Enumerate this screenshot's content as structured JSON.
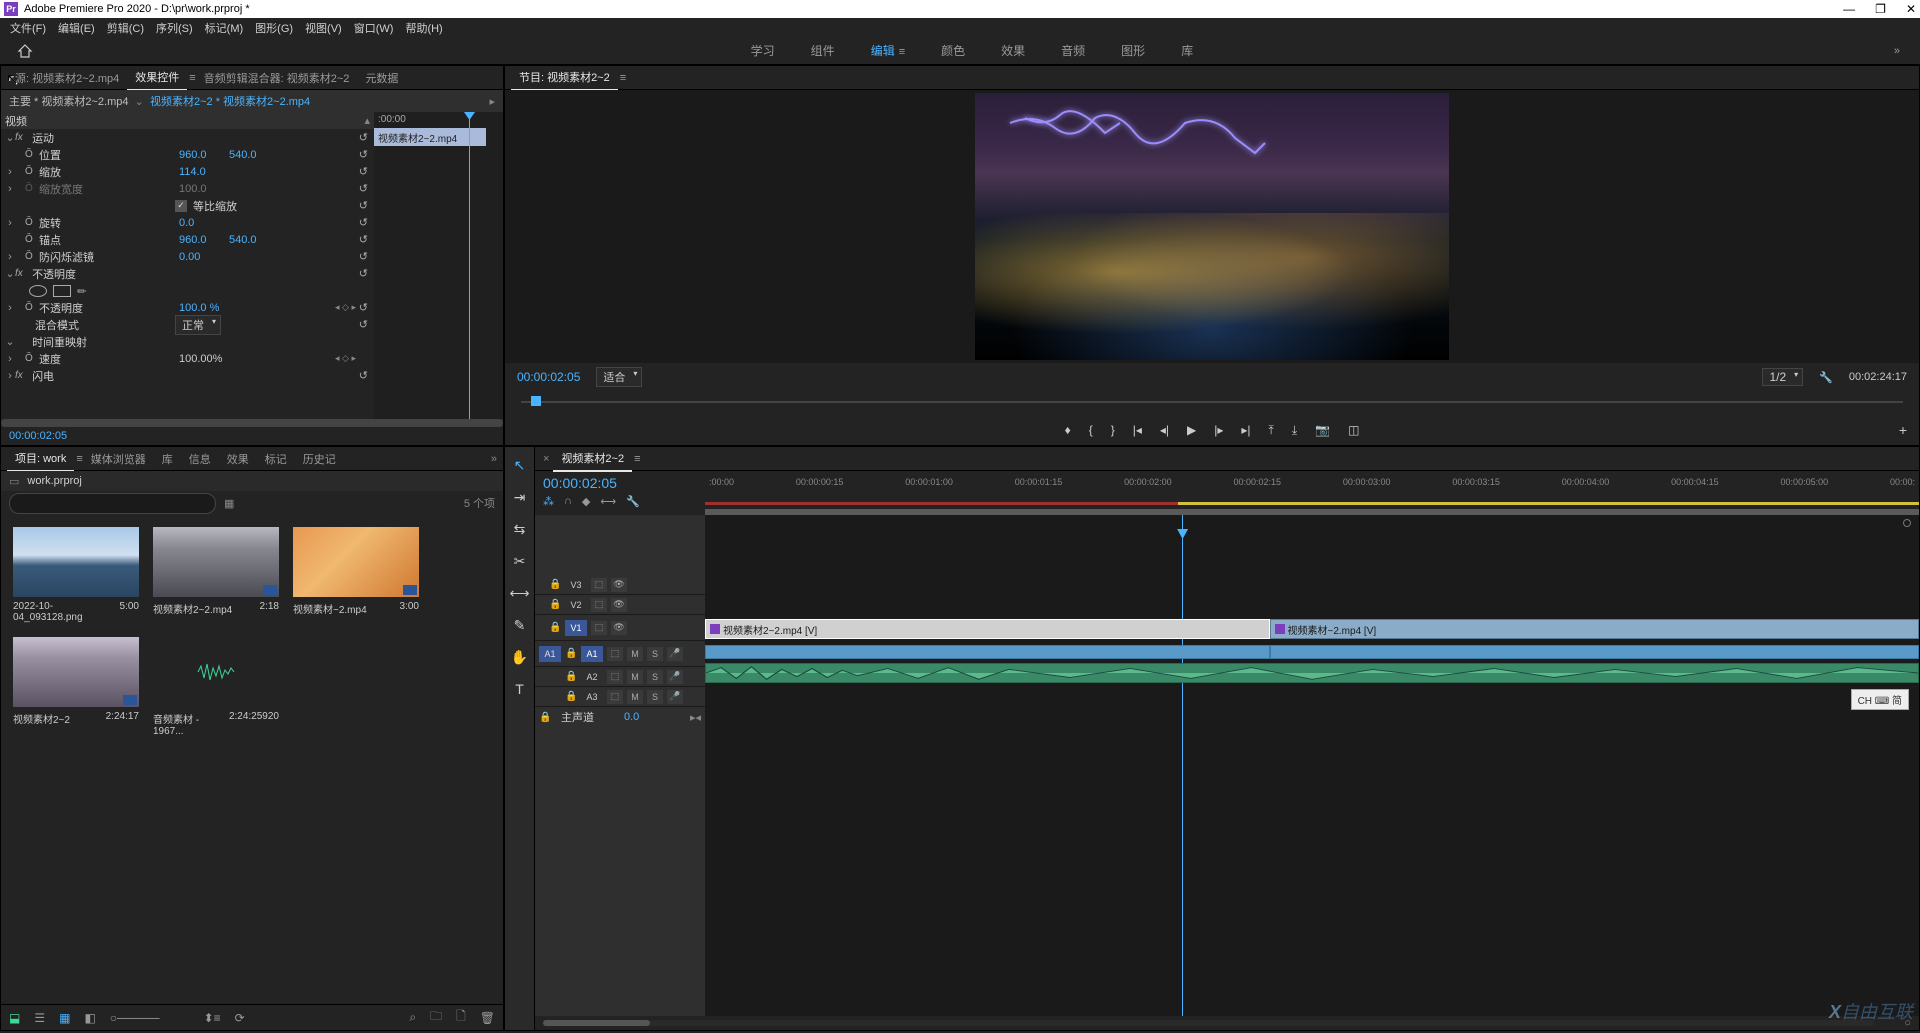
{
  "title": "Adobe Premiere Pro 2020 - D:\\pr\\work.prproj *",
  "menu": [
    "文件(F)",
    "编辑(E)",
    "剪辑(C)",
    "序列(S)",
    "标记(M)",
    "图形(G)",
    "视图(V)",
    "窗口(W)",
    "帮助(H)"
  ],
  "workspace": {
    "tabs": [
      "学习",
      "组件",
      "编辑",
      "颜色",
      "效果",
      "音频",
      "图形",
      "库"
    ],
    "active_index": 2
  },
  "source_tabs": {
    "source": "源: 视频素材2~2.mp4",
    "effect_controls": "效果控件",
    "audio_mixer": "音频剪辑混合器: 视频素材2~2",
    "metadata": "元数据"
  },
  "ec": {
    "master": "主要 * 视频素材2~2.mp4",
    "active": "视频素材2~2 * 视频素材2~2.mp4",
    "time_start": ":00:00",
    "clip_name": "视频素材2~2.mp4",
    "current": "00:00:02:05",
    "sections": {
      "video": "视频",
      "motion": "运动",
      "opacity": "不透明度",
      "timeremap": "时间重映射",
      "lightning": "闪电"
    },
    "props": {
      "position": {
        "label": "位置",
        "x": "960.0",
        "y": "540.0"
      },
      "scale": {
        "label": "缩放",
        "v": "114.0"
      },
      "scalew": {
        "label": "缩放宽度",
        "v": "100.0"
      },
      "uniform": {
        "label": "等比缩放",
        "checked": true
      },
      "rotation": {
        "label": "旋转",
        "v": "0.0"
      },
      "anchor": {
        "label": "锚点",
        "x": "960.0",
        "y": "540.0"
      },
      "flicker": {
        "label": "防闪烁滤镜",
        "v": "0.00"
      },
      "opacity": {
        "label": "不透明度",
        "v": "100.0 %"
      },
      "blend": {
        "label": "混合模式",
        "v": "正常"
      },
      "speed": {
        "label": "速度",
        "v": "100.00%"
      }
    }
  },
  "program": {
    "title": "节目: 视频素材2~2",
    "tc": "00:00:02:05",
    "fit": "适合",
    "fraction": "1/2",
    "duration": "00:02:24:17"
  },
  "project": {
    "tabs": [
      "项目: work",
      "媒体浏览器",
      "库",
      "信息",
      "效果",
      "标记",
      "历史记"
    ],
    "file": "work.prproj",
    "count": "5 个项",
    "items": [
      {
        "name": "2022-10-04_093128.png",
        "dur": "5:00",
        "thumb": "th-mountain"
      },
      {
        "name": "视频素材2~2.mp4",
        "dur": "2:18",
        "thumb": "th-city"
      },
      {
        "name": "视频素材~2.mp4",
        "dur": "3:00",
        "thumb": "th-leaves"
      },
      {
        "name": "视频素材2~2",
        "dur": "2:24:17",
        "thumb": "th-city2"
      },
      {
        "name": "音频素材 - 1967...",
        "dur": "2:24:25920",
        "thumb": "th-audio"
      }
    ]
  },
  "tools": [
    "select",
    "track-select",
    "ripple",
    "razor",
    "slip",
    "pen",
    "hand",
    "type"
  ],
  "timeline": {
    "seq_name": "视频素材2~2",
    "tc": "00:00:02:05",
    "ticks": [
      ":00:00",
      "00:00:00:15",
      "00:00:01:00",
      "00:00:01:15",
      "00:00:02:00",
      "00:00:02:15",
      "00:00:03:00",
      "00:00:03:15",
      "00:00:04:00",
      "00:00:04:15",
      "00:00:05:00",
      "00:00:"
    ],
    "tracks": {
      "v": [
        "V3",
        "V2",
        "V1"
      ],
      "a": [
        "A1",
        "A2",
        "A3"
      ],
      "audio_ctrls": [
        "M",
        "S"
      ]
    },
    "source_a1": "A1",
    "master": {
      "label": "主声道",
      "val": "0.0"
    },
    "clips": {
      "v1a": "视频素材2~2.mp4 [V]",
      "v1b": "视频素材~2.mp4 [V]"
    }
  },
  "ime": "CH ⌨ 简",
  "watermark": "自由互联"
}
